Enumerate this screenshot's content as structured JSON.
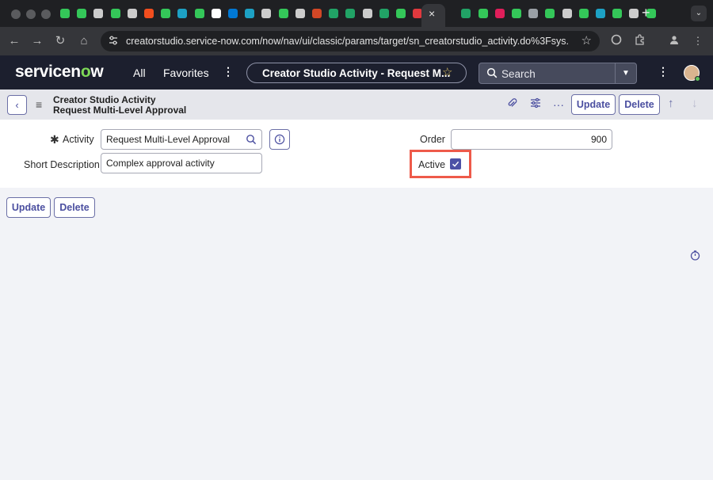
{
  "browser": {
    "url": "creatorstudio.service-now.com/now/nav/ui/classic/params/target/sn_creatorstudio_activity.do%3Fsys...",
    "close_tab_glyph": "×",
    "new_tab_glyph": "+",
    "tab_list_glyph": "⌄",
    "back_glyph": "←",
    "forward_glyph": "→",
    "reload_glyph": "↻",
    "home_glyph": "⌂",
    "tab_icon_colors": [
      "#34c759",
      "#34c759",
      "#cccccc",
      "#34c759",
      "#cccccc",
      "#f24e1e",
      "#34c759",
      "#1da1c4",
      "#34c759",
      "#ffffff",
      "#0078d4",
      "#1da1c4",
      "#cccccc",
      "#34c759",
      "#cccccc",
      "#d24726",
      "#21a366",
      "#21a366",
      "#cccccc",
      "#21a366",
      "#34c759",
      "#e0393e",
      "#21a366",
      "#34c759",
      "#e01e5a",
      "#34c759",
      "#9aa0a6",
      "#34c759",
      "#cccccc",
      "#34c759",
      "#1da1c4",
      "#34c759",
      "#cccccc",
      "#34c759"
    ]
  },
  "header": {
    "logo_text_1": "servicen",
    "logo_text_2": "o",
    "logo_text_3": "w",
    "nav_all": "All",
    "nav_favorites": "Favorites",
    "more_glyph": "⋮",
    "context_pill": "Creator Studio Activity - Request M...",
    "star_glyph": "☆",
    "search_placeholder": "Search",
    "search_dropdown_glyph": "▼"
  },
  "form_header": {
    "back_glyph": "‹",
    "menu_glyph": "≡",
    "title_line1": "Creator Studio Activity",
    "title_line2": "Request Multi-Level Approval",
    "attach_glyph": "📎",
    "settings_glyph": "⚙",
    "more_glyph": "···",
    "update_label": "Update",
    "delete_label": "Delete",
    "up_glyph": "↑",
    "down_glyph": "↓"
  },
  "form": {
    "required_marker": "✱",
    "activity_label": "Activity",
    "activity_value": "Request Multi-Level Approval",
    "short_description_label": "Short Description",
    "short_description_value": "Complex approval activity",
    "order_label": "Order",
    "order_value": "900",
    "active_label": "Active",
    "active_checked": true,
    "check_glyph": "✓"
  },
  "footer_buttons": {
    "update_label": "Update",
    "delete_label": "Delete"
  },
  "colors": {
    "accent": "#4b4fa0",
    "highlight": "#ee5a4a",
    "header_bg": "#1c1f2e",
    "logo_o": "#7ed957"
  }
}
